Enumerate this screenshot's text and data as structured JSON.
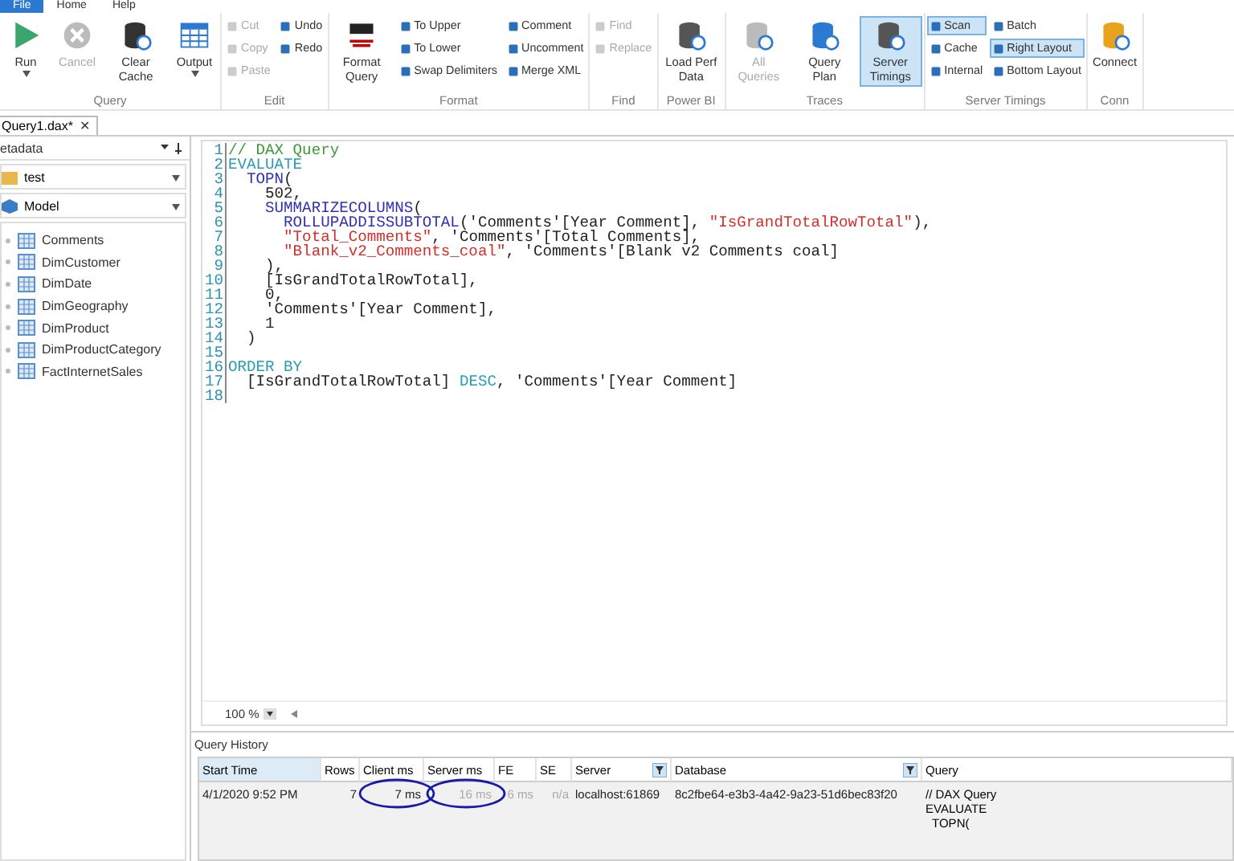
{
  "menu_tabs": [
    {
      "label": "File",
      "selected": true
    },
    {
      "label": "Home",
      "selected": false
    },
    {
      "label": "Help",
      "selected": false
    }
  ],
  "ribbon": [
    {
      "label": "Query",
      "items": [
        {
          "kind": "large",
          "label": "Run",
          "disabled": false,
          "selected": false,
          "caret": true
        },
        {
          "kind": "large",
          "label": "Cancel",
          "disabled": true,
          "selected": false,
          "caret": false
        },
        {
          "kind": "large",
          "label": "Clear Cache",
          "disabled": false,
          "selected": false,
          "caret": false
        },
        {
          "kind": "large",
          "label": "Output",
          "disabled": false,
          "selected": false,
          "caret": true
        }
      ]
    },
    {
      "label": "Edit",
      "items": [
        {
          "kind": "stack",
          "items": [
            {
              "label": "Cut",
              "disabled": true,
              "selected": false
            },
            {
              "label": "Copy",
              "disabled": true,
              "selected": false
            },
            {
              "label": "Paste",
              "disabled": true,
              "selected": false
            }
          ]
        },
        {
          "kind": "stack",
          "items": [
            {
              "label": "Undo",
              "disabled": false,
              "selected": false
            },
            {
              "label": "Redo",
              "disabled": false,
              "selected": false
            }
          ]
        }
      ]
    },
    {
      "label": "Format",
      "items": [
        {
          "kind": "large",
          "label": "Format Query",
          "disabled": false,
          "selected": false,
          "caret": false
        },
        {
          "kind": "stack",
          "items": [
            {
              "label": "To Upper",
              "disabled": false,
              "selected": false
            },
            {
              "label": "To Lower",
              "disabled": false,
              "selected": false
            },
            {
              "label": "Swap Delimiters",
              "disabled": false,
              "selected": false
            }
          ]
        },
        {
          "kind": "stack",
          "items": [
            {
              "label": "Comment",
              "disabled": false,
              "selected": false
            },
            {
              "label": "Uncomment",
              "disabled": false,
              "selected": false
            },
            {
              "label": "Merge XML",
              "disabled": false,
              "selected": false
            }
          ]
        }
      ]
    },
    {
      "label": "Find",
      "items": [
        {
          "kind": "stack",
          "items": [
            {
              "label": "Find",
              "disabled": true,
              "selected": false
            },
            {
              "label": "Replace",
              "disabled": true,
              "selected": false
            }
          ]
        }
      ]
    },
    {
      "label": "Power BI",
      "items": [
        {
          "kind": "large",
          "label": "Load Perf Data",
          "disabled": false,
          "selected": false,
          "caret": false
        }
      ]
    },
    {
      "label": "Traces",
      "items": [
        {
          "kind": "large",
          "label": "All Queries",
          "disabled": true,
          "selected": false,
          "caret": false
        },
        {
          "kind": "large",
          "label": "Query Plan",
          "disabled": false,
          "selected": false,
          "caret": false
        },
        {
          "kind": "large",
          "label": "Server Timings",
          "disabled": false,
          "selected": true,
          "caret": false
        }
      ]
    },
    {
      "label": "Server Timings",
      "items": [
        {
          "kind": "stack",
          "items": [
            {
              "label": "Scan",
              "disabled": false,
              "selected": true
            },
            {
              "label": "Cache",
              "disabled": false,
              "selected": false
            },
            {
              "label": "Internal",
              "disabled": false,
              "selected": false
            }
          ]
        },
        {
          "kind": "stack",
          "items": [
            {
              "label": "Batch",
              "disabled": false,
              "selected": false
            },
            {
              "label": "Right Layout",
              "disabled": false,
              "selected": true
            },
            {
              "label": "Bottom Layout",
              "disabled": false,
              "selected": false
            }
          ]
        }
      ]
    },
    {
      "label": "Conn",
      "items": [
        {
          "kind": "large",
          "label": "Connect",
          "disabled": false,
          "selected": false,
          "caret": false
        }
      ]
    }
  ],
  "document_tab": {
    "label": "Query1.dax*",
    "close": "✕"
  },
  "metadata": {
    "title": "etadata",
    "database": "test",
    "model": "Model",
    "tables": [
      "Comments",
      "DimCustomer",
      "DimDate",
      "DimGeography",
      "DimProduct",
      "DimProductCategory",
      "FactInternetSales"
    ]
  },
  "editor": {
    "lines": [
      {
        "number": "1",
        "tokens": [
          {
            "kind": "comment",
            "text": "// DAX Query"
          }
        ]
      },
      {
        "number": "2",
        "tokens": [
          {
            "kind": "keyword",
            "text": "EVALUATE"
          }
        ]
      },
      {
        "number": "3",
        "tokens": [
          {
            "kind": "function",
            "text": "  TOPN"
          },
          {
            "kind": "plain",
            "text": "("
          }
        ]
      },
      {
        "number": "4",
        "tokens": [
          {
            "kind": "plain",
            "text": "    502,"
          }
        ]
      },
      {
        "number": "5",
        "tokens": [
          {
            "kind": "function",
            "text": "    SUMMARIZECOLUMNS"
          },
          {
            "kind": "plain",
            "text": "("
          }
        ]
      },
      {
        "number": "6",
        "tokens": [
          {
            "kind": "function",
            "text": "      ROLLUPADDISSUBTOTAL"
          },
          {
            "kind": "plain",
            "text": "('Comments'[Year Comment], "
          },
          {
            "kind": "string",
            "text": "\"IsGrandTotalRowTotal\""
          },
          {
            "kind": "plain",
            "text": "),"
          }
        ]
      },
      {
        "number": "7",
        "tokens": [
          {
            "kind": "string",
            "text": "      \"Total_Comments\""
          },
          {
            "kind": "plain",
            "text": ", 'Comments'[Total Comments],"
          }
        ]
      },
      {
        "number": "8",
        "tokens": [
          {
            "kind": "string",
            "text": "      \"Blank_v2_Comments_coal\""
          },
          {
            "kind": "plain",
            "text": ", 'Comments'[Blank v2 Comments coal]"
          }
        ]
      },
      {
        "number": "9",
        "tokens": [
          {
            "kind": "plain",
            "text": "    ),"
          }
        ]
      },
      {
        "number": "10",
        "tokens": [
          {
            "kind": "plain",
            "text": "    [IsGrandTotalRowTotal],"
          }
        ]
      },
      {
        "number": "11",
        "tokens": [
          {
            "kind": "plain",
            "text": "    0,"
          }
        ]
      },
      {
        "number": "12",
        "tokens": [
          {
            "kind": "plain",
            "text": "    'Comments'[Year Comment],"
          }
        ]
      },
      {
        "number": "13",
        "tokens": [
          {
            "kind": "plain",
            "text": "    1"
          }
        ]
      },
      {
        "number": "14",
        "tokens": [
          {
            "kind": "plain",
            "text": "  )"
          }
        ]
      },
      {
        "number": "15"
      },
      {
        "number": "16",
        "tokens": [
          {
            "kind": "keyword",
            "text": "ORDER BY"
          }
        ]
      },
      {
        "number": "17",
        "tokens": [
          {
            "kind": "plain",
            "text": "  [IsGrandTotalRowTotal] "
          },
          {
            "kind": "keyword",
            "text": "DESC"
          },
          {
            "kind": "plain",
            "text": ", 'Comments'[Year Comment]"
          }
        ]
      },
      {
        "number": "18"
      }
    ],
    "zoom": "100 %"
  },
  "query_history": {
    "title": "Query History",
    "columns": [
      "Start Time",
      "Rows",
      "Client ms",
      "Server ms",
      "FE",
      "SE",
      "Server",
      "Database",
      "Query"
    ],
    "rows": [
      {
        "start_time": "4/1/2020 9:52 PM",
        "rows": "7",
        "client_ms": "7 ms",
        "server_ms": "16 ms",
        "fe": "6 ms",
        "se": "n/a",
        "server": "localhost:61869",
        "database": "8c2fbe64-e3b3-4a42-9a23-51d6bec83f20",
        "query": [
          "// DAX Query",
          "EVALUATE",
          "  TOPN("
        ]
      }
    ]
  }
}
